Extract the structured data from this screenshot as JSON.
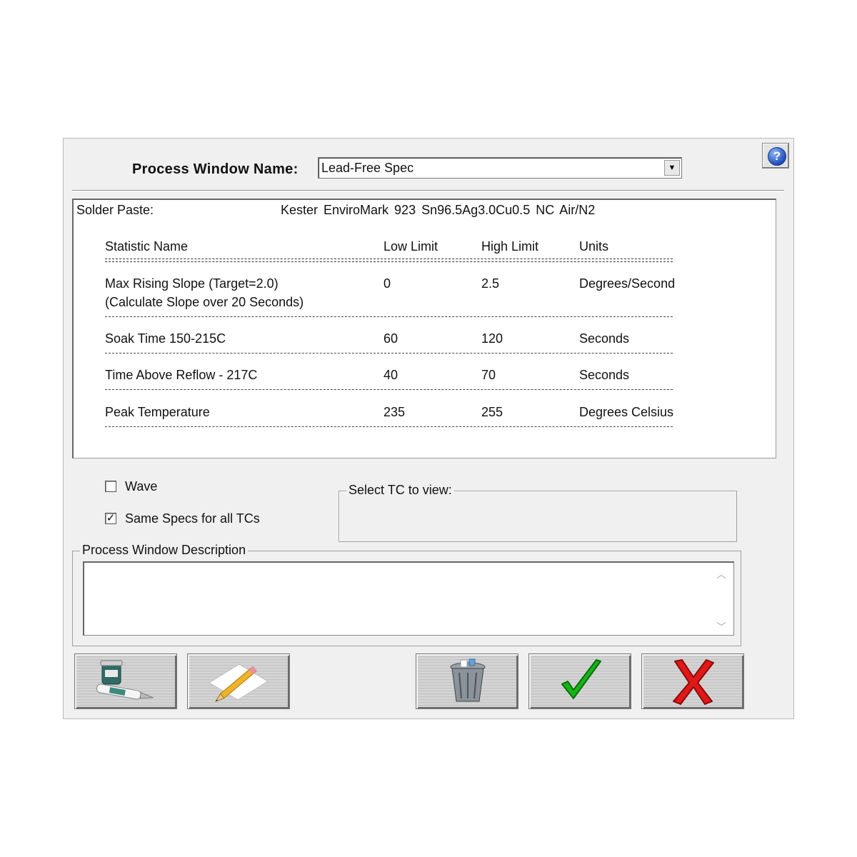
{
  "header": {
    "process_window_label": "Process Window Name:",
    "process_window_value": "Lead-Free Spec"
  },
  "help": {
    "icon": "help-icon",
    "glyph": "?"
  },
  "spec": {
    "solder_paste_label": "Solder Paste:",
    "solder_paste_value": "Kester  EnviroMark 923  Sn96.5Ag3.0Cu0.5  NC  Air/N2",
    "columns": {
      "name": "Statistic Name",
      "low": "Low Limit",
      "high": "High Limit",
      "units": "Units"
    },
    "rows": [
      {
        "name": "Max Rising Slope (Target=2.0)",
        "note": "(Calculate Slope over 20 Seconds)",
        "low": "0",
        "high": "2.5",
        "units": "Degrees/Second"
      },
      {
        "name": "Soak Time 150-215C",
        "low": "60",
        "high": "120",
        "units": "Seconds"
      },
      {
        "name": "Time Above Reflow - 217C",
        "low": "40",
        "high": "70",
        "units": "Seconds"
      },
      {
        "name": "Peak Temperature",
        "low": "235",
        "high": "255",
        "units": "Degrees Celsius"
      }
    ]
  },
  "options": {
    "wave": {
      "label": "Wave",
      "checked": false
    },
    "same_specs": {
      "label": "Same Specs for all TCs",
      "checked": true
    }
  },
  "tc_group": {
    "title": "Select TC to view:"
  },
  "description": {
    "title": "Process Window Description",
    "value": ""
  },
  "toolbar": {
    "buttons": [
      {
        "name": "solder-paste-button",
        "icon": "solder-paste-icon"
      },
      {
        "name": "edit-button",
        "icon": "pencil-paper-icon"
      },
      {
        "name": "delete-button",
        "icon": "trash-can-icon"
      },
      {
        "name": "ok-button",
        "icon": "green-check-icon"
      },
      {
        "name": "cancel-button",
        "icon": "red-x-icon"
      }
    ]
  },
  "colors": {
    "dialog_bg": "#f0f0f0",
    "check_green": "#17b317",
    "cross_red": "#e01818",
    "help_blue": "#1f4fb8"
  }
}
